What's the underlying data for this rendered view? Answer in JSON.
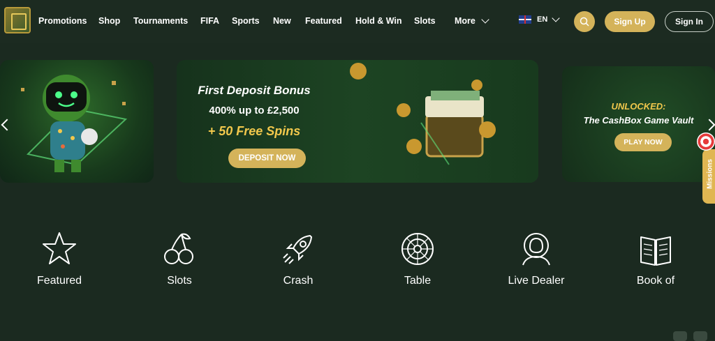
{
  "nav": {
    "items": [
      "Promotions",
      "Shop",
      "Tournaments",
      "FIFA",
      "Sports",
      "New",
      "Featured",
      "Hold & Win",
      "Slots",
      "More"
    ],
    "language": "EN",
    "signup_label": "Sign Up",
    "signin_label": "Sign In"
  },
  "banners": {
    "deposit": {
      "title": "First Deposit Bonus",
      "subtitle": "400% up to £2,500",
      "spins": "+ 50 Free Spins",
      "button": "DEPOSIT NOW"
    },
    "vault": {
      "heading": "UNLOCKED:",
      "title": "The CashBox Game Vault",
      "button": "PLAY NOW"
    }
  },
  "missions_label": "Missions",
  "categories": [
    {
      "label": "Featured",
      "icon": "star-icon"
    },
    {
      "label": "Slots",
      "icon": "cherry-icon"
    },
    {
      "label": "Crash",
      "icon": "rocket-icon"
    },
    {
      "label": "Table",
      "icon": "roulette-icon"
    },
    {
      "label": "Live Dealer",
      "icon": "dealer-icon"
    },
    {
      "label": "Book of",
      "icon": "book-icon"
    }
  ],
  "colors": {
    "accent": "#d4b35a",
    "background": "#1b2a20",
    "highlight": "#f2c84c"
  }
}
